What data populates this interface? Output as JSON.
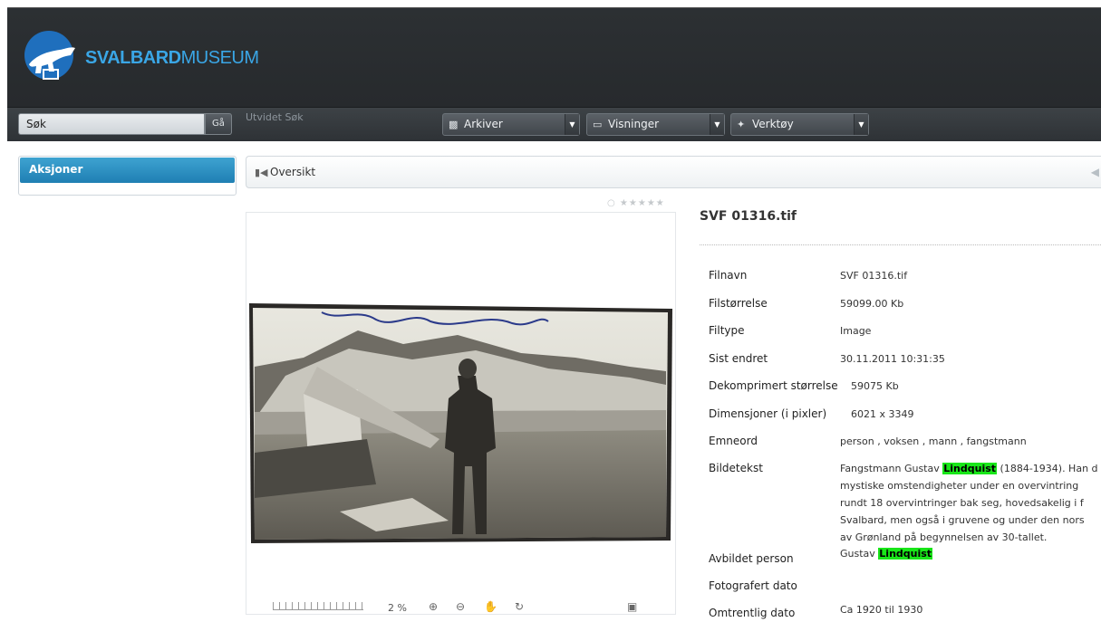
{
  "header": {
    "logo_bold": "SVALBARD",
    "logo_light": "MUSEUM"
  },
  "toolbar": {
    "search_placeholder": "Søk",
    "search_value": "Søk",
    "go_label": "Gå",
    "advanced_search": "Utvidet Søk",
    "menus": [
      {
        "label": "Arkiver",
        "icon": "archive-icon"
      },
      {
        "label": "Visninger",
        "icon": "monitor-icon"
      },
      {
        "label": "Verktøy",
        "icon": "tools-icon"
      }
    ]
  },
  "sidebar": {
    "heading": "Aksjoner"
  },
  "breadcrumb": {
    "label": "Oversikt"
  },
  "viewer": {
    "zoom": "2 %"
  },
  "details": {
    "title": "SVF 01316.tif",
    "fields": [
      {
        "key": "Filnavn",
        "value": "SVF 01316.tif"
      },
      {
        "key": "Filstørrelse",
        "value": "59099.00 Kb"
      },
      {
        "key": "Filtype",
        "value": "Image"
      },
      {
        "key": "Sist endret",
        "value": "30.11.2011 10:31:35"
      },
      {
        "key": "Dekomprimert størrelse",
        "value": "59075 Kb"
      },
      {
        "key": "Dimensjoner (i pixler)",
        "value": "6021 x 3349"
      },
      {
        "key": "Emneord",
        "value": "person , voksen , mann , fangstmann"
      }
    ],
    "caption_key": "Bildetekst",
    "caption_pre": "Fangstmann Gustav ",
    "caption_highlight": "Lindquist",
    "caption_post": " (1884-1934). Han d",
    "caption_lines": [
      "mystiske omstendigheter under en overvintring",
      "rundt 18 overvintringer bak seg, hovedsakelig i f",
      "Svalbard, men også i gruvene og under den nors",
      "av Grønland på begynnelsen av 30-tallet."
    ],
    "person_key": "Avbildet person",
    "person_pre": "Gustav ",
    "person_highlight": "Lindquist",
    "photo_date_key": "Fotografert dato",
    "approx_date_key": "Omtrentlig dato",
    "approx_date_value": "Ca 1920 til 1930"
  }
}
